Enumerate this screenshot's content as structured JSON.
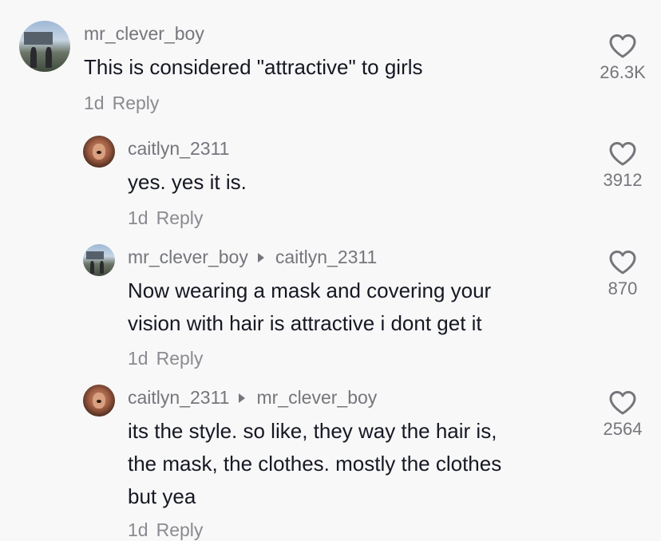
{
  "comments": [
    {
      "username": "mr_clever_boy",
      "reply_to": "",
      "text_lines": [
        "This is considered \"attractive\" to girls"
      ],
      "time": "1d",
      "reply_label": "Reply",
      "likes": "26.3K",
      "avatar_icon": "park-photo-avatar"
    },
    {
      "username": "caitlyn_2311",
      "reply_to": "",
      "text_lines": [
        "yes. yes it is."
      ],
      "time": "1d",
      "reply_label": "Reply",
      "likes": "3912",
      "avatar_icon": "girl-photo-avatar"
    },
    {
      "username": "mr_clever_boy",
      "reply_to": "caitlyn_2311",
      "text_lines": [
        "Now wearing a mask and covering your",
        "vision with hair is attractive i dont get it"
      ],
      "time": "1d",
      "reply_label": "Reply",
      "likes": "870",
      "avatar_icon": "park-photo-avatar"
    },
    {
      "username": "caitlyn_2311",
      "reply_to": "mr_clever_boy",
      "text_lines": [
        "its the style. so like, they way the hair is,",
        "the mask, the clothes. mostly the clothes",
        "but yea"
      ],
      "time": "1d",
      "reply_label": "Reply",
      "likes": "2564",
      "avatar_icon": "girl-photo-avatar"
    }
  ]
}
